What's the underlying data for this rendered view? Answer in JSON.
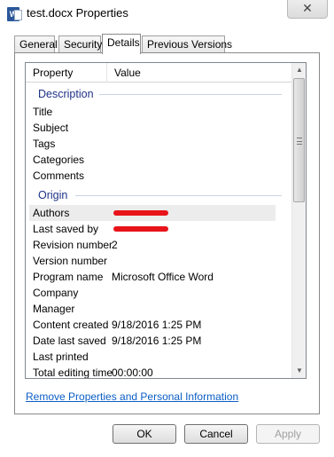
{
  "window": {
    "title": "test.docx Properties",
    "close_glyph": "✕"
  },
  "tabs": [
    {
      "label": "General"
    },
    {
      "label": "Security"
    },
    {
      "label": "Details",
      "active": true
    },
    {
      "label": "Previous Versions"
    }
  ],
  "list": {
    "columns": {
      "property": "Property",
      "value": "Value"
    },
    "groups": {
      "description": "Description",
      "origin": "Origin"
    },
    "description_rows": [
      {
        "key": "Title",
        "value": ""
      },
      {
        "key": "Subject",
        "value": ""
      },
      {
        "key": "Tags",
        "value": ""
      },
      {
        "key": "Categories",
        "value": ""
      },
      {
        "key": "Comments",
        "value": ""
      }
    ],
    "origin_rows": [
      {
        "key": "Authors",
        "value": "",
        "redacted": true,
        "selected": true
      },
      {
        "key": "Last saved by",
        "value": "",
        "redacted": true
      },
      {
        "key": "Revision number",
        "value": "2"
      },
      {
        "key": "Version number",
        "value": ""
      },
      {
        "key": "Program name",
        "value": "Microsoft Office Word"
      },
      {
        "key": "Company",
        "value": ""
      },
      {
        "key": "Manager",
        "value": ""
      },
      {
        "key": "Content created",
        "value": "9/18/2016 1:25 PM"
      },
      {
        "key": "Date last saved",
        "value": "9/18/2016 1:25 PM"
      },
      {
        "key": "Last printed",
        "value": ""
      },
      {
        "key": "Total editing time",
        "value": "00:00:00"
      }
    ],
    "scrollbar": {
      "up_glyph": "▲",
      "down_glyph": "▼"
    }
  },
  "remove_link": "Remove Properties and Personal Information",
  "buttons": {
    "ok": "OK",
    "cancel": "Cancel",
    "apply": "Apply"
  },
  "colors": {
    "group_header": "#1e3287",
    "link": "#0b5ec5",
    "redaction": "#e8141a"
  },
  "icons": {
    "app": "word-document-icon",
    "close": "close-icon"
  }
}
